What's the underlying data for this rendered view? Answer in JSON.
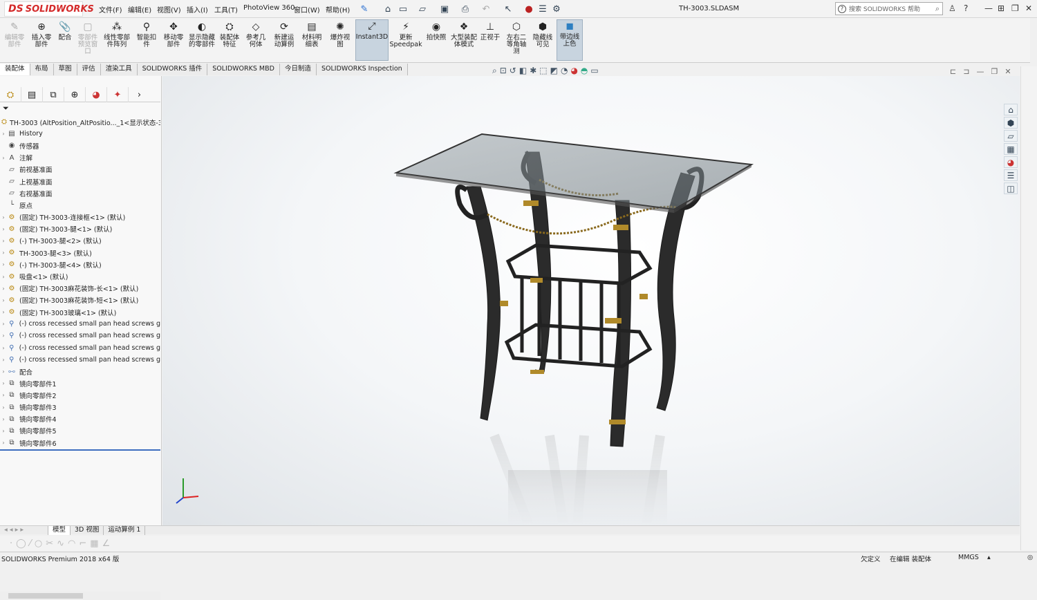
{
  "app": {
    "brand": "SOLIDWORKS",
    "brand_mark": "DS",
    "document_title": "TH-3003.SLDASM"
  },
  "menu": [
    "文件(F)",
    "编辑(E)",
    "视图(V)",
    "插入(I)",
    "工具(T)",
    "PhotoView 360",
    "窗口(W)",
    "帮助(H)"
  ],
  "search": {
    "placeholder": "搜索 SOLIDWORKS 帮助"
  },
  "ribbon": [
    {
      "label": "编辑零部件",
      "icon": "edit-component-icon",
      "disabled": true
    },
    {
      "label": "插入零部件",
      "icon": "insert-component-icon"
    },
    {
      "label": "配合",
      "icon": "mate-icon"
    },
    {
      "label": "零部件预览窗口",
      "icon": "preview-icon",
      "disabled": true
    },
    {
      "label": "线性零部件阵列",
      "icon": "linear-pattern-icon"
    },
    {
      "label": "智能扣件",
      "icon": "smart-fastener-icon"
    },
    {
      "label": "移动零部件",
      "icon": "move-component-icon"
    },
    {
      "label": "显示隐藏的零部件",
      "icon": "show-hidden-icon"
    },
    {
      "label": "装配体特征",
      "icon": "assembly-feature-icon"
    },
    {
      "label": "参考几何体",
      "icon": "reference-geometry-icon"
    },
    {
      "label": "新建运动算例",
      "icon": "motion-study-icon"
    },
    {
      "label": "材料明细表",
      "icon": "bom-icon"
    },
    {
      "label": "爆炸视图",
      "icon": "exploded-view-icon"
    },
    {
      "label": "Instant3D",
      "icon": "instant3d-icon",
      "active": true
    },
    {
      "label": "更新Speedpak",
      "icon": "speedpak-icon"
    },
    {
      "label": "拍快照",
      "icon": "snapshot-icon"
    },
    {
      "label": "大型装配体模式",
      "icon": "large-assembly-icon"
    },
    {
      "label": "正视于",
      "icon": "normal-to-icon"
    },
    {
      "label": "左右二等角轴测",
      "icon": "dimetric-icon"
    },
    {
      "label": "隐藏线可见",
      "icon": "hidden-lines-icon"
    },
    {
      "label": "带边线上色",
      "icon": "shaded-edges-icon",
      "active": true
    }
  ],
  "tabs": [
    "装配体",
    "布局",
    "草图",
    "评估",
    "渲染工具",
    "SOLIDWORKS 插件",
    "SOLIDWORKS MBD",
    "今日制造",
    "SOLIDWORKS Inspection"
  ],
  "tree": {
    "root": "TH-3003 (AltPosition_AltPositio..._1<显示状态-3",
    "items": [
      {
        "label": "History",
        "icon": "history-icon",
        "expand": true
      },
      {
        "label": "传感器",
        "icon": "sensor-icon"
      },
      {
        "label": "注解",
        "icon": "annotation-icon",
        "expand": true
      },
      {
        "label": "前视基准面",
        "icon": "plane-icon"
      },
      {
        "label": "上视基准面",
        "icon": "plane-icon"
      },
      {
        "label": "右视基准面",
        "icon": "plane-icon"
      },
      {
        "label": "原点",
        "icon": "origin-icon"
      },
      {
        "label": "(固定) TH-3003-连接框<1> (默认)",
        "icon": "part-icon",
        "expand": true
      },
      {
        "label": "(固定) TH-3003-腿<1> (默认)",
        "icon": "part-icon",
        "expand": true
      },
      {
        "label": "(-) TH-3003-腿<2> (默认)",
        "icon": "part-icon",
        "expand": true
      },
      {
        "label": "TH-3003-腿<3> (默认)",
        "icon": "part-icon",
        "expand": true
      },
      {
        "label": "(-) TH-3003-腿<4> (默认)",
        "icon": "part-icon",
        "expand": true
      },
      {
        "label": "吸盘<1> (默认)",
        "icon": "part-icon",
        "expand": true
      },
      {
        "label": "(固定) TH-3003麻花装饰-长<1> (默认)",
        "icon": "part-icon",
        "expand": true
      },
      {
        "label": "(固定) TH-3003麻花装饰-短<1> (默认)",
        "icon": "part-icon",
        "expand": true
      },
      {
        "label": "(固定) TH-3003玻璃<1> (默认)",
        "icon": "part-icon",
        "expand": true
      },
      {
        "label": "(-) cross recessed small pan head screws g",
        "icon": "screw-icon",
        "expand": true
      },
      {
        "label": "(-) cross recessed small pan head screws g",
        "icon": "screw-icon",
        "expand": true
      },
      {
        "label": "(-) cross recessed small pan head screws g",
        "icon": "screw-icon",
        "expand": true
      },
      {
        "label": "(-) cross recessed small pan head screws g",
        "icon": "screw-icon",
        "expand": true
      },
      {
        "label": "配合",
        "icon": "mates-icon",
        "expand": true
      },
      {
        "label": "镜向零部件1",
        "icon": "mirror-icon",
        "expand": true
      },
      {
        "label": "镜向零部件2",
        "icon": "mirror-icon",
        "expand": true
      },
      {
        "label": "镜向零部件3",
        "icon": "mirror-icon",
        "expand": true
      },
      {
        "label": "镜向零部件4",
        "icon": "mirror-icon",
        "expand": true
      },
      {
        "label": "镜向零部件5",
        "icon": "mirror-icon",
        "expand": true
      },
      {
        "label": "镜向零部件6",
        "icon": "mirror-icon",
        "expand": true
      }
    ]
  },
  "bottom_tabs": [
    "模型",
    "3D 视图",
    "运动算例 1"
  ],
  "status": {
    "left": "SOLIDWORKS Premium 2018 x64 版",
    "state1": "欠定义",
    "state2": "在编辑 装配体",
    "units": "MMGS"
  }
}
